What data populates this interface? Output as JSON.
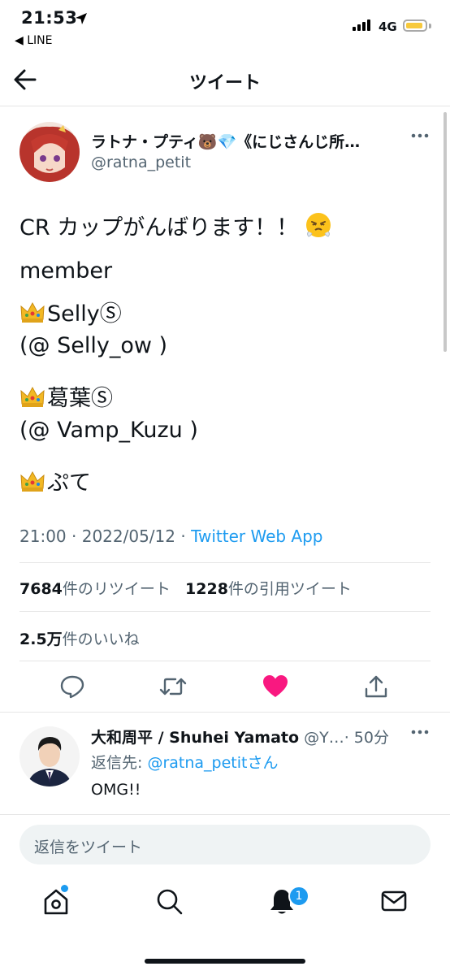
{
  "status_bar": {
    "time": "21:53",
    "back_app": "◀ LINE",
    "network": "4G"
  },
  "nav": {
    "title": "ツイート"
  },
  "tweet": {
    "author_name": "ラトナ・プティ🐻💎《にじさんじ所…",
    "author_handle": "@ratna_petit",
    "lines": [
      "CR カップがんばります！！",
      "member",
      "Selly",
      "(@ Selly_ow )",
      "葛葉",
      "(@ Vamp_Kuzu )",
      "ぷて"
    ],
    "circled_s": "Ⓢ",
    "time": "21:00",
    "date": "2022/05/12",
    "separator": "·",
    "via": "Twitter Web App",
    "retweets_count": "7684",
    "retweets_label": "件のリツイート",
    "quotes_count": "1228",
    "quotes_label": "件の引用ツイート",
    "likes_count": "2.5万",
    "likes_label": "件のいいね"
  },
  "reply": {
    "name": "大和周平 / Shuhei Yamato",
    "handle": "@Y…",
    "time": "· 50分",
    "reply_prefix": "返信先: ",
    "reply_mention": "@ratna_petit",
    "reply_suffix": "さん",
    "text": "OMG!!"
  },
  "compose": {
    "placeholder": "返信をツイート"
  },
  "tabs": {
    "notifications_badge": "1"
  },
  "icons": [
    "location-arrow-icon",
    "signal-icon",
    "battery-icon",
    "back-arrow-icon",
    "more-icon",
    "crown-icon",
    "huffing-face-icon",
    "reply-icon",
    "retweet-icon",
    "like-icon",
    "share-icon",
    "home-icon",
    "search-icon",
    "bell-icon",
    "mail-icon"
  ],
  "colors": {
    "accent": "#1d9bf0",
    "like": "#f91880",
    "secondary_text": "#536471",
    "battery": "#f7c93c"
  }
}
